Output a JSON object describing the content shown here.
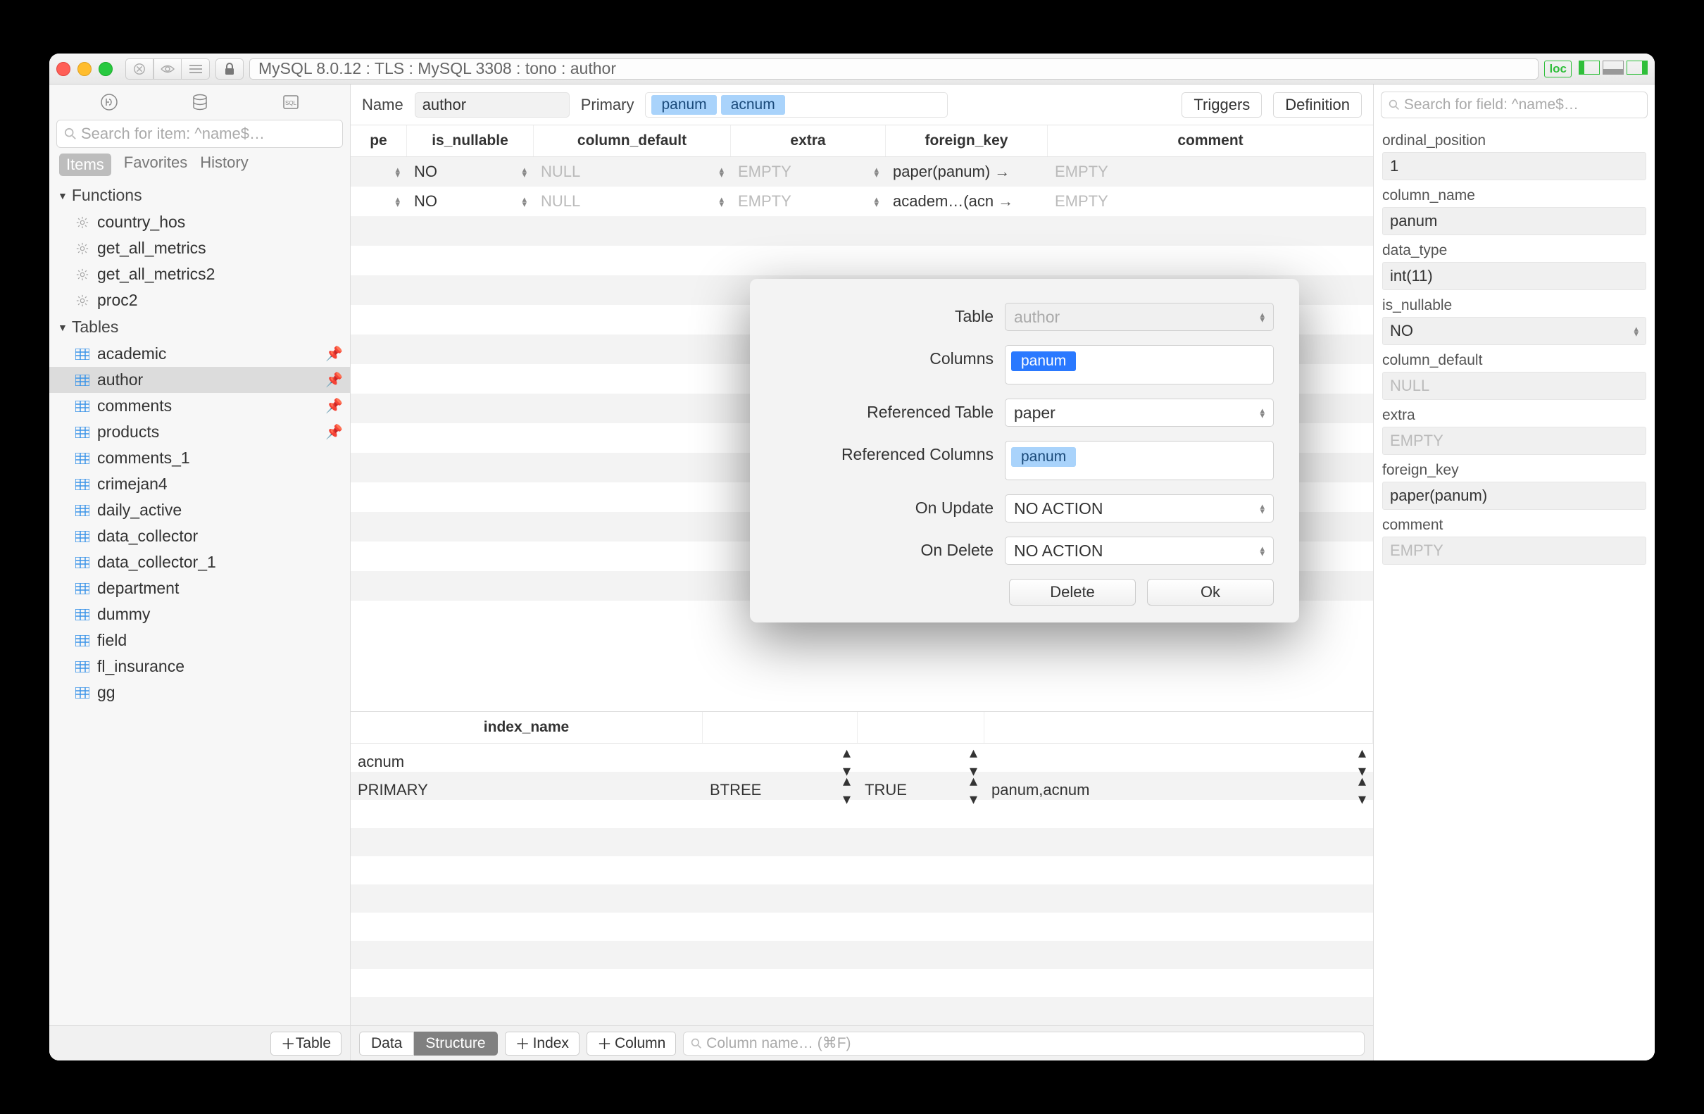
{
  "title_path": "MySQL 8.0.12 : TLS : MySQL 3308 : tono : author",
  "badge_loc": "loc",
  "sidebar": {
    "search_placeholder": "Search for item: ^name$…",
    "tabs": {
      "items": "Items",
      "favorites": "Favorites",
      "history": "History"
    },
    "sections": {
      "functions": {
        "label": "Functions",
        "items": [
          "country_hos",
          "get_all_metrics",
          "get_all_metrics2",
          "proc2"
        ]
      },
      "tables": {
        "label": "Tables",
        "items": [
          {
            "n": "academic",
            "pin": true
          },
          {
            "n": "author",
            "pin": true,
            "sel": true
          },
          {
            "n": "comments",
            "pin": true
          },
          {
            "n": "products",
            "pin": true
          },
          {
            "n": "comments_1"
          },
          {
            "n": "crimejan4"
          },
          {
            "n": "daily_active"
          },
          {
            "n": "data_collector"
          },
          {
            "n": "data_collector_1"
          },
          {
            "n": "department"
          },
          {
            "n": "dummy"
          },
          {
            "n": "field"
          },
          {
            "n": "fl_insurance"
          },
          {
            "n": "gg"
          }
        ]
      }
    },
    "add_table": "Table"
  },
  "header": {
    "name_lbl": "Name",
    "name_val": "author",
    "primary_lbl": "Primary",
    "primary_cols": [
      "panum",
      "acnum"
    ],
    "triggers": "Triggers",
    "definition": "Definition"
  },
  "columns": {
    "headers": {
      "pe": "pe",
      "nullable": "is_nullable",
      "default": "column_default",
      "extra": "extra",
      "fk": "foreign_key",
      "comment": "comment"
    },
    "rows": [
      {
        "nullable": "NO",
        "default": "NULL",
        "extra": "EMPTY",
        "fk": "paper(panum)",
        "comment": "EMPTY"
      },
      {
        "nullable": "NO",
        "default": "NULL",
        "extra": "EMPTY",
        "fk": "academ…(acn",
        "comment": "EMPTY"
      }
    ]
  },
  "index": {
    "header": "index_name",
    "rows": [
      {
        "name": "acnum",
        "method": "",
        "unique": "",
        "cols": ""
      },
      {
        "name": "PRIMARY",
        "method": "BTREE",
        "unique": "TRUE",
        "cols": "panum,acnum"
      }
    ]
  },
  "footer": {
    "data": "Data",
    "structure": "Structure",
    "add_index": "Index",
    "add_column": "Column",
    "search_placeholder": "Column name… (⌘F)"
  },
  "right": {
    "search_placeholder": "Search for field: ^name$…",
    "props": [
      {
        "k": "ordinal_position",
        "v": "1"
      },
      {
        "k": "column_name",
        "v": "panum"
      },
      {
        "k": "data_type",
        "v": "int(11)"
      },
      {
        "k": "is_nullable",
        "v": "NO",
        "sel": true
      },
      {
        "k": "column_default",
        "v": "NULL",
        "mut": true
      },
      {
        "k": "extra",
        "v": "EMPTY",
        "mut": true
      },
      {
        "k": "foreign_key",
        "v": "paper(panum)"
      },
      {
        "k": "comment",
        "v": "EMPTY",
        "mut": true
      }
    ]
  },
  "modal": {
    "table_lbl": "Table",
    "table_val": "author",
    "cols_lbl": "Columns",
    "cols": [
      "panum"
    ],
    "reft_lbl": "Referenced Table",
    "reft_val": "paper",
    "refc_lbl": "Referenced Columns",
    "refc": [
      "panum"
    ],
    "onu_lbl": "On Update",
    "onu_val": "NO ACTION",
    "ond_lbl": "On Delete",
    "ond_val": "NO ACTION",
    "delete": "Delete",
    "ok": "Ok"
  }
}
